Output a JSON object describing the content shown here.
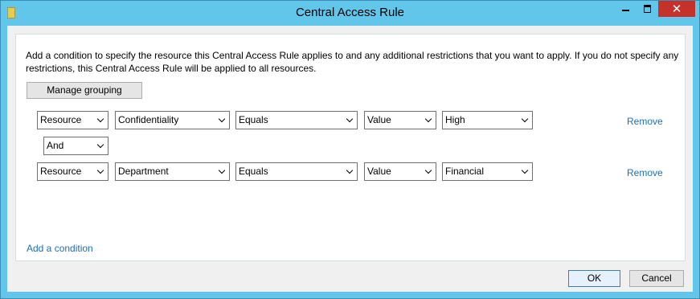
{
  "window": {
    "title": "Central Access Rule",
    "close_glyph": "✕"
  },
  "description": "Add a condition to specify the resource this Central Access Rule applies to and any additional restrictions that you want to apply. If you do not specify any restrictions, this Central Access Rule will be applied to all resources.",
  "manage_grouping_label": "Manage grouping",
  "conditions": [
    {
      "scope": "Resource",
      "attribute": "Confidentiality",
      "operator": "Equals",
      "value_type": "Value",
      "value": "High",
      "remove_label": "Remove"
    },
    {
      "scope": "Resource",
      "attribute": "Department",
      "operator": "Equals",
      "value_type": "Value",
      "value": "Financial",
      "remove_label": "Remove"
    }
  ],
  "connector": "And",
  "add_condition_label": "Add a condition",
  "ok_label": "OK",
  "cancel_label": "Cancel",
  "icons": [
    "folder-icon",
    "minimize-icon",
    "maximize-icon",
    "close-icon",
    "chevron-down-icon"
  ]
}
